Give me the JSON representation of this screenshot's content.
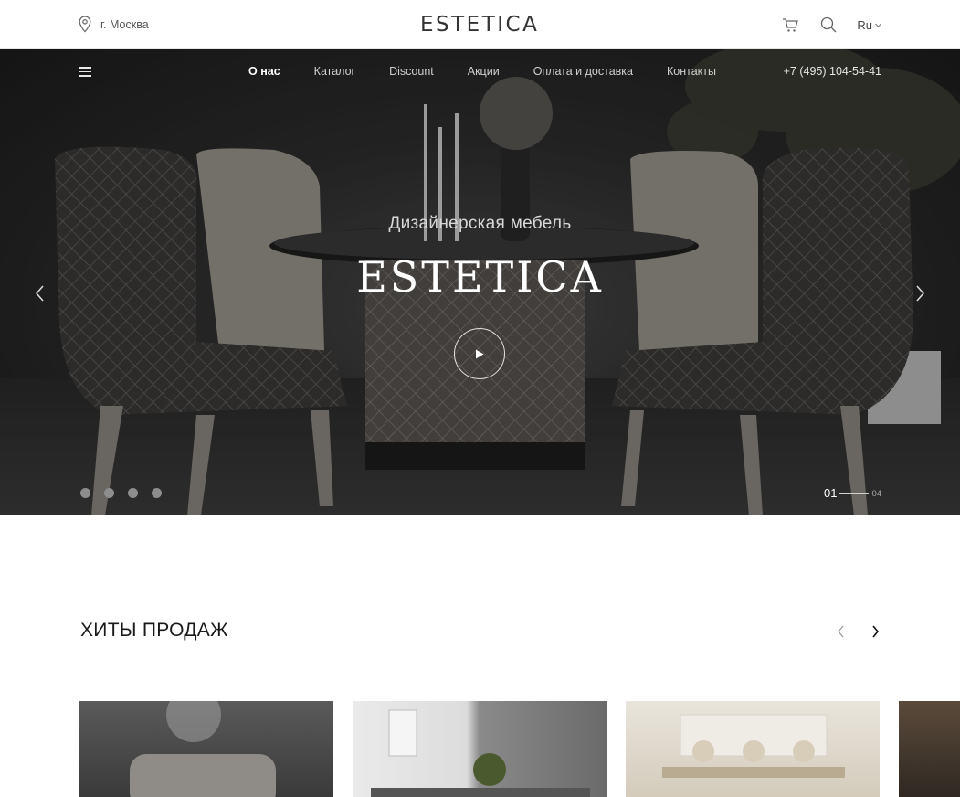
{
  "topbar": {
    "location": "г. Москва",
    "logo": "ESTETICA",
    "language": "Ru",
    "icons": [
      "location-pin-icon",
      "cart-icon",
      "search-icon",
      "chevron-down-icon"
    ]
  },
  "nav": {
    "items": [
      "О нас",
      "Каталог",
      "Discount",
      "Акции",
      "Оплата и доставка",
      "Контакты"
    ],
    "active_index": 0,
    "phone": "+7 (495) 104-54-41"
  },
  "hero": {
    "subtitle": "Дизайнерская мебель",
    "title": "ESTETICA",
    "slide_current": "01",
    "slide_total": "04",
    "socials": [
      "instagram-icon",
      "facebook-icon",
      "vk-icon",
      "youtube-icon"
    ]
  },
  "bestsellers": {
    "title": "ХИТЫ ПРОДАЖ"
  }
}
